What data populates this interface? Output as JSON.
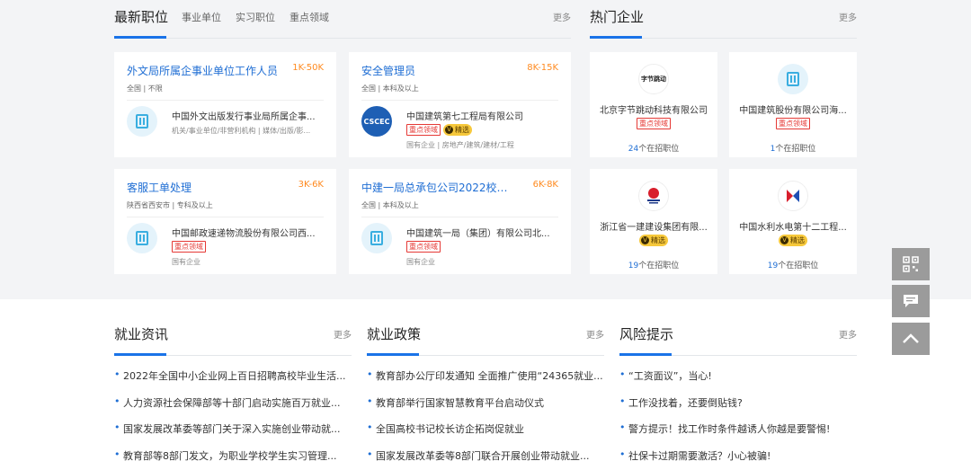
{
  "latest_jobs": {
    "title": "最新职位",
    "tabs": [
      "事业单位",
      "实习职位",
      "重点领域"
    ],
    "more": "更多",
    "cards": [
      {
        "title": "外文局所属企事业单位工作人员",
        "salary": "1K-50K",
        "meta": "全国 | 不限",
        "company": "中国外文出版发行事业局所属企事...",
        "tags": [],
        "selected": false,
        "sub": "机关/事业单位/非营利机构 | 媒体/出版/影..."
      },
      {
        "title": "安全管理员",
        "salary": "8K-15K",
        "meta": "全国 | 本科及以上",
        "company": "中国建筑第七工程局有限公司",
        "tags": [
          "重点领域"
        ],
        "selected": true,
        "selected_label": "精选",
        "sub": "国有企业 | 房地产/建筑/建材/工程"
      },
      {
        "title": "客服工单处理",
        "salary": "3K-6K",
        "meta": "陕西省西安市 | 专科及以上",
        "company": "中国邮政速递物流股份有限公司西...",
        "tags": [
          "重点领域"
        ],
        "selected": false,
        "sub": "国有企业"
      },
      {
        "title": "中建一局总承包公司2022校园...",
        "salary": "6K-8K",
        "meta": "全国 | 本科及以上",
        "company": "中国建筑一局（集团）有限公司北...",
        "tags": [
          "重点领域"
        ],
        "selected": false,
        "sub": "国有企业"
      }
    ]
  },
  "hot_companies": {
    "title": "热门企业",
    "more": "更多",
    "items": [
      {
        "name": "北京字节跳动科技有限公司",
        "tag": "重点领域",
        "tag_type": "red",
        "count": "24",
        "count_suffix": "个在招职位",
        "logo_text": "字节跳动"
      },
      {
        "name": "中国建筑股份有限公司海...",
        "tag": "重点领域",
        "tag_type": "red",
        "count": "1",
        "count_suffix": "个在招职位",
        "logo_text": ""
      },
      {
        "name": "浙江省一建建设集团有限...",
        "tag": "精选",
        "tag_type": "selected",
        "count": "19",
        "count_suffix": "个在招职位",
        "logo_text": "浙江一建"
      },
      {
        "name": "中国水利水电第十二工程...",
        "tag": "精选",
        "tag_type": "selected",
        "count": "19",
        "count_suffix": "个在招职位",
        "logo_text": "中国电建"
      }
    ]
  },
  "news": {
    "title": "就业资讯",
    "more": "更多",
    "items": [
      "2022年全国中小企业网上百日招聘高校毕业生活...",
      "人力资源社会保障部等十部门启动实施百万就业...",
      "国家发展改革委等部门关于深入实施创业带动就...",
      "教育部等8部门发文，为职业学校学生实习管理..."
    ]
  },
  "policy": {
    "title": "就业政策",
    "more": "更多",
    "items": [
      "教育部办公厅印发通知 全面推广使用“24365就业...",
      "教育部举行国家智慧教育平台启动仪式",
      "全国高校书记校长访企拓岗促就业",
      "国家发展改革委等8部门联合开展创业带动就业..."
    ]
  },
  "risk": {
    "title": "风险提示",
    "more": "更多",
    "items": [
      "“工资面议”，当心!",
      "工作没找着，还要倒贴钱?",
      "警方提示！找工作时条件越诱人你越是要警惕!",
      "社保卡过期需要激活？小心被骗!"
    ]
  },
  "side_buttons": {
    "qr": "qr-code-icon",
    "chat": "chat-icon",
    "top": "chevron-up-icon"
  },
  "colors": {
    "accent": "#1a73e8",
    "salary": "#ff8a1f",
    "tag_red": "#e53935",
    "selected": "#f6c83b"
  }
}
